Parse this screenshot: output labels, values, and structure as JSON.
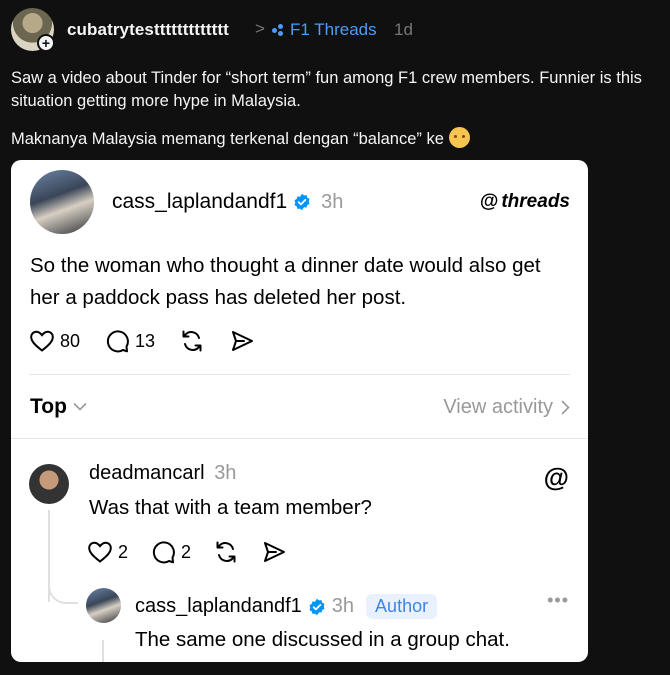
{
  "outer_post": {
    "username": "cubatrytesttttttttttttt",
    "separator": ">",
    "community": "F1 Threads",
    "time": "1d",
    "text_1": "Saw a video about Tinder for “short term” fun among F1 crew members. Funnier is this situation getting more hype in Malaysia.",
    "text_2": "Maknanya Malaysia memang terkenal dengan “balance” ke",
    "emoji_icon": "pleading-face-icon"
  },
  "embedded_post": {
    "username": "cass_laplandandf1",
    "time": "3h",
    "brand": "threads",
    "text": "So the woman who thought a dinner date would also get her a paddock pass has deleted her post.",
    "likes": "80",
    "replies": "13",
    "sort_label": "Top",
    "view_activity": "View activity"
  },
  "reply": {
    "username": "deadmancarl",
    "time": "3h",
    "text": "Was that with a team member?",
    "likes": "2",
    "replies": "2"
  },
  "nested_reply": {
    "username": "cass_laplandandf1",
    "time": "3h",
    "badge": "Author",
    "text": "The same one discussed in a group chat.",
    "more": "•••"
  },
  "colors": {
    "background": "#101010",
    "link_blue": "#4a9df8",
    "verified_blue": "#0095f6",
    "author_badge_bg": "#e8f1fd"
  }
}
